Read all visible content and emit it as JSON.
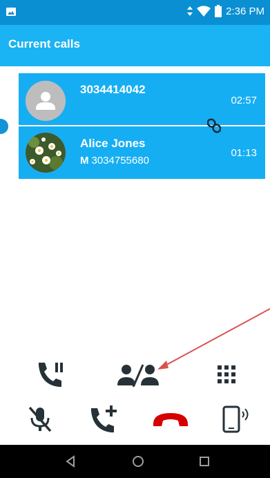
{
  "status_bar": {
    "time": "2:36 PM",
    "icons": [
      "image-icon",
      "data-arrows-icon",
      "wifi-icon",
      "battery-icon"
    ]
  },
  "app_bar": {
    "title": "Current calls"
  },
  "calls": [
    {
      "number": "3034414042",
      "duration": "02:57",
      "avatar": "default-contact-icon"
    },
    {
      "name": "Alice Jones",
      "number_type": "M",
      "number": "3034755680",
      "duration": "01:13",
      "avatar": "contact-photo"
    }
  ],
  "controls": {
    "row1": [
      "hold-call-icon",
      "swap-calls-icon",
      "dialpad-icon"
    ],
    "row2": [
      "mute-off-icon",
      "add-call-icon",
      "end-call-icon",
      "speaker-phone-icon"
    ]
  },
  "colors": {
    "status_bar": "#0a8fd3",
    "app_bar": "#1ab3f3",
    "call_card": "#16aef3",
    "end_call": "#d50000",
    "annotation_arrow": "#d9534f"
  },
  "nav_bar": [
    "back-icon",
    "home-icon",
    "recents-icon"
  ]
}
